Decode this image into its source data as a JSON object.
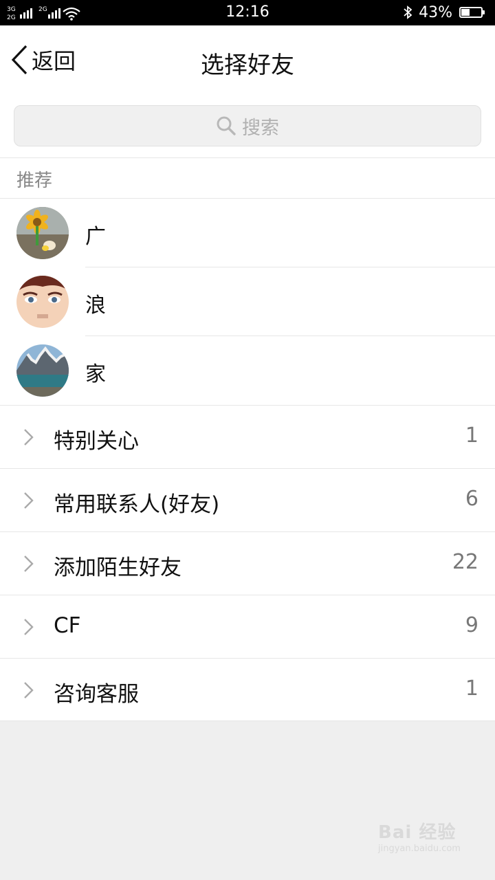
{
  "status_bar": {
    "network_1": "3G",
    "network_2": "2G",
    "network_3": "2G",
    "time": "12:16",
    "bluetooth_icon": "bluetooth-icon",
    "battery_percent": "43%",
    "battery_level": 0.43
  },
  "nav": {
    "back_label": "返回",
    "title": "选择好友"
  },
  "search": {
    "placeholder": "搜索"
  },
  "recommended": {
    "header": "推荐",
    "contacts": [
      {
        "name": "广"
      },
      {
        "name": "浪"
      },
      {
        "name": "家"
      }
    ]
  },
  "groups": [
    {
      "name": "特别关心",
      "count": "1"
    },
    {
      "name": "常用联系人(好友)",
      "count": "6"
    },
    {
      "name": "添加陌生好友",
      "count": "22"
    },
    {
      "name": "CF",
      "count": "9"
    },
    {
      "name": "咨询客服",
      "count": "1"
    }
  ],
  "watermark": {
    "text": "Bai 经验",
    "sub": "jingyan.baidu.com"
  },
  "colors": {
    "background": "#efefef",
    "text_primary": "#111111",
    "text_secondary": "#888888",
    "divider": "#e6e6e6"
  }
}
